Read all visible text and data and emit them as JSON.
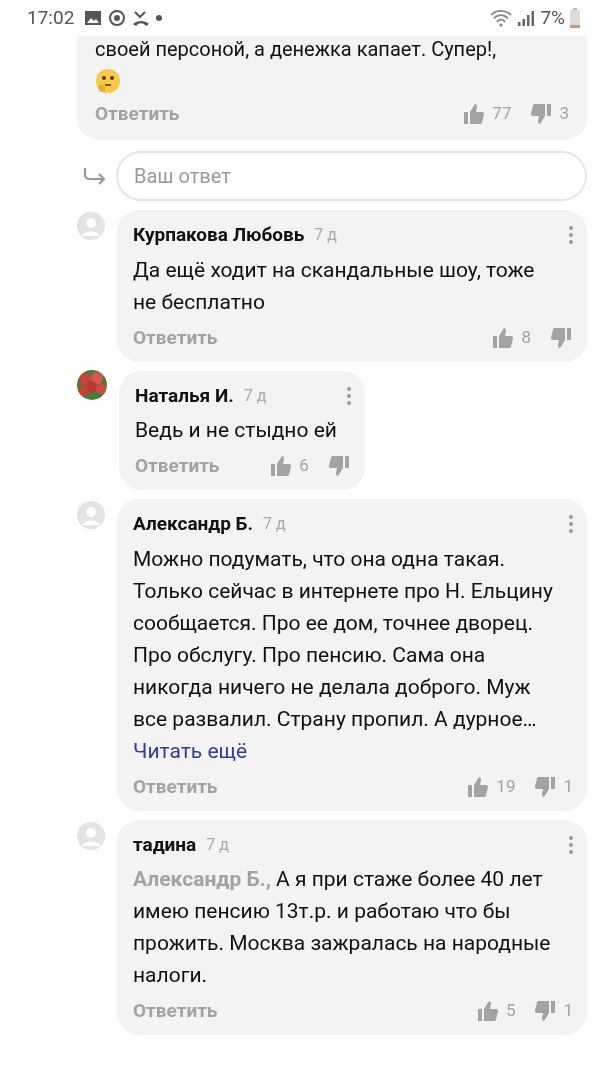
{
  "status_bar": {
    "time": "17:02",
    "battery": "7%"
  },
  "top_comment": {
    "body": "своей персоной, а денежка капает. Супер!,",
    "reply": "Ответить",
    "likes": "77",
    "dislikes": "3"
  },
  "reply_field": {
    "placeholder": "Ваш ответ"
  },
  "comments": [
    {
      "avatar": {
        "kind": "default"
      },
      "author": "Курпакова Любовь",
      "time": "7 д",
      "body": "Да ещё ходит на скандальные шоу, тоже не бесплатно",
      "reply": "Ответить",
      "likes": "8"
    },
    {
      "author": "Наталья И.",
      "time": "7 д",
      "body": "Ведь и не стыдно ей",
      "reply": "Ответить",
      "likes": "6"
    },
    {
      "avatar": {
        "kind": "default"
      },
      "author": "Александр Б.",
      "time": "7 д",
      "body": "Можно подумать, что она одна такая. Только сейчас в интернете про Н. Ельцину сообщается. Про ее дом, точнее дворец. Про обслугу. Про пенсию. Сама она никогда ничего не делала доброго. Муж все развалил. Страну пропил. А дурное…",
      "read_more": "Читать ещё",
      "reply": "Ответить",
      "likes": "19",
      "dislikes": "1"
    },
    {
      "avatar": {
        "kind": "default"
      },
      "author": "тадина",
      "time": "7 д",
      "body": "**Александр Б.,** А я при стаже более 40 лет имею пенсию 13т.р. и работаю что бы прожить. Москва зажралась на народные налоги.",
      "reply": "Ответить",
      "likes": "5",
      "dislikes": "1"
    }
  ]
}
